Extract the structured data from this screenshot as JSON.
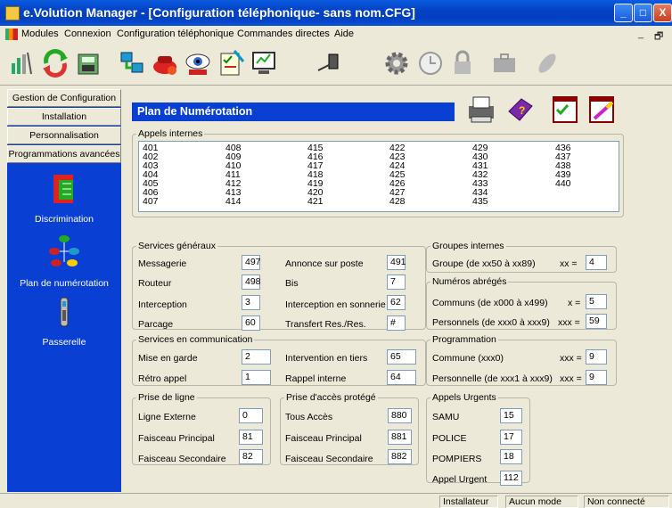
{
  "window": {
    "title": "e.Volution Manager - [Configuration téléphonique- sans nom.CFG]",
    "controls": {
      "minimize": "_",
      "maximize": "□",
      "close": "X"
    }
  },
  "menu": {
    "items": [
      "Modules",
      "Connexion",
      "Configuration téléphonique",
      "Commandes directes",
      "Aide"
    ],
    "mdi_minimize": "_",
    "mdi_restore": "🗗"
  },
  "toolbar": {
    "icons": [
      "antenna-icon",
      "recycle-icon",
      "fax-icon",
      "network-icon",
      "phone-colors-icon",
      "eye-icon",
      "checklist-icon",
      "monitor-icon",
      "plug-icon",
      "gear-icon",
      "clock-icon",
      "lock-icon",
      "briefcase-icon",
      "pen-icon"
    ]
  },
  "nav": {
    "buttons": [
      "Gestion de Configuration",
      "Installation",
      "Personnalisation",
      "Programmations avancées"
    ],
    "icons": [
      {
        "label": "Discrimination",
        "icon": "book-icon"
      },
      {
        "label": "Plan de numérotation",
        "icon": "phone-network-icon"
      },
      {
        "label": "Passerelle",
        "icon": "handset-icon"
      }
    ]
  },
  "main": {
    "header": "Plan de Numérotation",
    "header_icons": [
      "printer-icon",
      "help-book-icon",
      "apply-check-icon",
      "edit-icon"
    ],
    "appels_internes": {
      "legend": "Appels internes",
      "columns": [
        [
          "401",
          "402",
          "403",
          "404",
          "405",
          "406",
          "407"
        ],
        [
          "408",
          "409",
          "410",
          "411",
          "412",
          "413",
          "414"
        ],
        [
          "415",
          "416",
          "417",
          "418",
          "419",
          "420",
          "421"
        ],
        [
          "422",
          "423",
          "424",
          "425",
          "426",
          "427",
          "428"
        ],
        [
          "429",
          "430",
          "431",
          "432",
          "433",
          "434",
          "435"
        ],
        [
          "436",
          "437",
          "438",
          "439",
          "440"
        ]
      ]
    },
    "services_generaux": {
      "legend": "Services généraux",
      "left": [
        {
          "label": "Messagerie",
          "value": "497"
        },
        {
          "label": "Routeur",
          "value": "498"
        },
        {
          "label": "Interception",
          "value": "3"
        },
        {
          "label": "Parcage",
          "value": "60"
        }
      ],
      "right": [
        {
          "label": "Annonce sur poste",
          "value": "491"
        },
        {
          "label": "Bis",
          "value": "7"
        },
        {
          "label": "Interception en sonnerie",
          "value": "62"
        },
        {
          "label": "Transfert Res./Res.",
          "value": "#"
        }
      ]
    },
    "groupes_internes": {
      "legend": "Groupes internes",
      "label": "Groupe (de xx50 à xx89)",
      "var": "xx =",
      "value": "4"
    },
    "numeros_abreges": {
      "legend": "Numéros abrégés",
      "rows": [
        {
          "label": "Communs (de x000 à x499)",
          "var": "x =",
          "value": "5"
        },
        {
          "label": "Personnels (de xxx0 à xxx9)",
          "var": "xxx =",
          "value": "59"
        }
      ]
    },
    "services_communication": {
      "legend": "Services en communication",
      "rows": [
        {
          "label": "Mise en garde",
          "value": "2",
          "label2": "Intervention en tiers",
          "value2": "65"
        },
        {
          "label": "Rétro appel",
          "value": "1",
          "label2": "Rappel interne",
          "value2": "64"
        }
      ]
    },
    "programmation": {
      "legend": "Programmation",
      "rows": [
        {
          "label": "Commune  (xxx0)",
          "var": "xxx =",
          "value": "9"
        },
        {
          "label": "Personnelle  (de xxx1 à xxx9)",
          "var": "xxx =",
          "value": "9"
        }
      ]
    },
    "prise_ligne": {
      "legend": "Prise de ligne",
      "rows": [
        {
          "label": "Ligne Externe",
          "value": "0"
        },
        {
          "label": "Faisceau Principal",
          "value": "81"
        },
        {
          "label": "Faisceau Secondaire",
          "value": "82"
        }
      ]
    },
    "prise_acces": {
      "legend": "Prise d'accès protégé",
      "rows": [
        {
          "label": "Tous Accès",
          "value": "880"
        },
        {
          "label": "Faisceau Principal",
          "value": "881"
        },
        {
          "label": "Faisceau Secondaire",
          "value": "882"
        }
      ]
    },
    "appels_urgents": {
      "legend": "Appels Urgents",
      "rows": [
        {
          "label": "SAMU",
          "value": "15"
        },
        {
          "label": "POLICE",
          "value": "17"
        },
        {
          "label": "POMPIERS",
          "value": "18"
        },
        {
          "label": "Appel Urgent",
          "value": "112"
        }
      ]
    }
  },
  "status": [
    "Installateur",
    "Aucun mode",
    "Non connecté"
  ]
}
